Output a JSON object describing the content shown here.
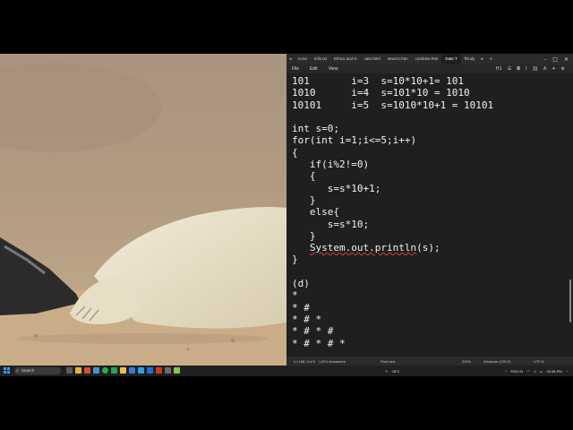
{
  "editor": {
    "tabs": [
      "AI.txt",
      "Infix.txt",
      "Ethics and si",
      "cats.html",
      "newcm.htm",
      "combine.htm",
      "Date T",
      "fRody"
    ],
    "active_tab_index": 6,
    "menu": [
      "File",
      "Edit",
      "View"
    ],
    "toolbar_heading": "H1",
    "code_lines": [
      "101       i=3  s=10*10+1= 101",
      "1010      i=4  s=101*10 = 1010",
      "10101     i=5  s=1010*10+1 = 10101",
      "",
      "int s=0;",
      "for(int i=1;i<=5;i++)",
      "{",
      "   if(i%2!=0)",
      "   {",
      "      s=s*10+1;",
      "   }",
      "   else{",
      "      s=s*10;",
      "   }",
      "   System.out.println(s);",
      "}",
      "",
      "(d)",
      "*",
      "* #",
      "* # *",
      "* # * #",
      "* # * # *"
    ],
    "status": {
      "position": "Ln 188, Col 5",
      "characters": "1,874 characters",
      "format": "Plain text",
      "zoom": "230%",
      "line_ending": "Windows (CRLF)",
      "encoding": "UTF-8"
    }
  },
  "taskbar": {
    "search_placeholder": "Search",
    "weather": "28°C",
    "language": "ENG IN",
    "time": "09:38 PM"
  },
  "colors": {
    "editor_bg": "#1f1f1f",
    "taskbar_bg": "#202020",
    "start_blue": "#3d9bf0"
  }
}
